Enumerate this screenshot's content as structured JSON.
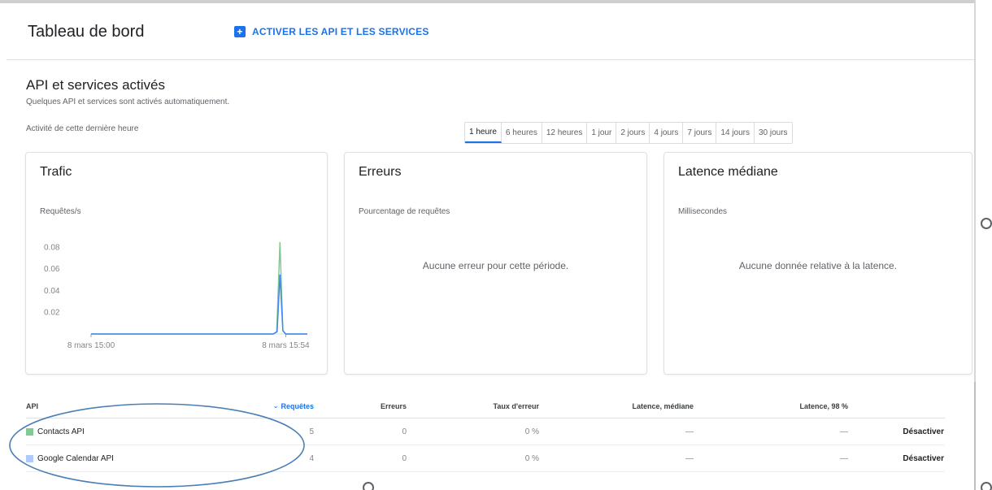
{
  "header": {
    "title": "Tableau de bord",
    "enable_button_label": "ACTIVER LES API ET LES SERVICES",
    "enable_button_icon": "plus-box-icon"
  },
  "section": {
    "title": "API et services activés",
    "subtitle": "Quelques API et services sont activés automatiquement.",
    "activity_label": "Activité de cette dernière heure"
  },
  "time_ranges": [
    {
      "label": "1 heure",
      "active": true
    },
    {
      "label": "6 heures",
      "active": false
    },
    {
      "label": "12 heures",
      "active": false
    },
    {
      "label": "1 jour",
      "active": false
    },
    {
      "label": "2 jours",
      "active": false
    },
    {
      "label": "4 jours",
      "active": false
    },
    {
      "label": "7 jours",
      "active": false
    },
    {
      "label": "14 jours",
      "active": false
    },
    {
      "label": "30 jours",
      "active": false
    }
  ],
  "cards": {
    "traffic": {
      "title": "Trafic",
      "unit": "Requêtes/s"
    },
    "errors": {
      "title": "Erreurs",
      "unit": "Pourcentage de requêtes",
      "empty": "Aucune erreur pour cette période."
    },
    "latency": {
      "title": "Latence médiane",
      "unit": "Millisecondes",
      "empty": "Aucune donnée relative à la latence."
    }
  },
  "chart_data": {
    "type": "line",
    "x_ticks": [
      "8 mars 15:00",
      "8 mars 15:54"
    ],
    "y_ticks": [
      0.02,
      0.04,
      0.06,
      0.08
    ],
    "ylim": [
      0,
      0.1
    ],
    "xlim": [
      0,
      60
    ],
    "xlabel": "",
    "ylabel": "Requêtes/s",
    "series": [
      {
        "color": "#81c995",
        "points": [
          [
            0,
            0
          ],
          [
            50.5,
            0
          ],
          [
            51.5,
            0.002
          ],
          [
            52.4,
            0.085
          ],
          [
            53.2,
            0.003
          ],
          [
            54,
            0
          ],
          [
            60,
            0
          ]
        ]
      },
      {
        "color": "#4285f4",
        "points": [
          [
            0,
            0
          ],
          [
            50.5,
            0
          ],
          [
            51.6,
            0.002
          ],
          [
            52.4,
            0.055
          ],
          [
            53.2,
            0.003
          ],
          [
            54,
            0
          ],
          [
            60,
            0
          ]
        ]
      }
    ],
    "grid": false,
    "legend": "none"
  },
  "table": {
    "headers": {
      "api": "API",
      "requests": "Requêtes",
      "errors": "Erreurs",
      "error_rate": "Taux d'erreur",
      "latency_median": "Latence, médiane",
      "latency_98": "Latence, 98 %"
    },
    "sort_icon": "arrow-down-icon",
    "rows": [
      {
        "name": "Contacts API",
        "color": "#81c995",
        "requests": "5",
        "errors": "0",
        "error_rate": "0 %",
        "latency_median": "—",
        "latency_98": "—",
        "action": "Désactiver"
      },
      {
        "name": "Google Calendar API",
        "color": "#aecbfa",
        "requests": "4",
        "errors": "0",
        "error_rate": "0 %",
        "latency_median": "—",
        "latency_98": "—",
        "action": "Désactiver"
      }
    ]
  },
  "colors": {
    "accent": "#1a73e8",
    "annotation": "#4a7fb5"
  }
}
